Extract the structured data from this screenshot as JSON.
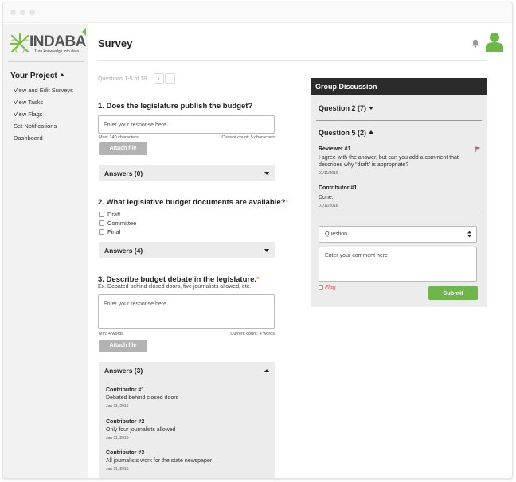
{
  "brand": {
    "name": "INDABA",
    "tagline": "Turn knowledge into data",
    "accent": "#7cbf3f"
  },
  "sidebar": {
    "project": "Your Project",
    "items": [
      {
        "label": "View and Edit Surveys"
      },
      {
        "label": "View Tasks"
      },
      {
        "label": "View Flags"
      },
      {
        "label": "Set Notifications"
      },
      {
        "label": "Dashboard"
      }
    ]
  },
  "header": {
    "title": "Survey",
    "icons": [
      "bell-icon",
      "user-avatar-icon"
    ]
  },
  "pager": {
    "label": "Questions 1-5 of 18",
    "prev": "‹",
    "next": "›"
  },
  "questions": [
    {
      "title": "1. Does the legislature publish the budget?",
      "placeholder": "Enter your response here",
      "limit": "Max: 140 characters",
      "count": "Current count: 5 characters",
      "attach": "Attach file",
      "answers_label": "Answers (0)"
    },
    {
      "title": "2. What legislative budget documents are available?",
      "required": "*",
      "options": [
        "Draft",
        "Committee",
        "Final"
      ],
      "answers_label": "Answers (4)"
    },
    {
      "title": "3. Describe budget debate in the legislature.",
      "required": "*",
      "hint": "Ex. Debated behind closed doors, five journalists allowed, etc.",
      "placeholder": "Enter your response here",
      "limit": "Min: 4 words",
      "count": "Current count: 4 words",
      "attach": "Attach file",
      "answers_label": "Answers (3)",
      "answers": [
        {
          "name": "Contributor #1",
          "text": "Debated behind closed doors",
          "date": "Jan 11, 2016"
        },
        {
          "name": "Contributor #2",
          "text": "Only four journalists allowed",
          "date": "Jan 11, 2016"
        },
        {
          "name": "Contributor #3",
          "text": "All journalists work for the state newspaper",
          "date": "Jan 11, 2016"
        }
      ]
    }
  ],
  "discussion": {
    "title": "Group Discussion",
    "collapsed_section": "Question 2 (7)",
    "open_section": "Question 5 (2)",
    "comments": [
      {
        "name": "Reviewer #1",
        "text": "I agree with the answer, but can you add a comment that describes why “draft” is appropriate?",
        "date": "01/11/2016",
        "flagged": true
      },
      {
        "name": "Contributor #1",
        "text": "Done.",
        "date": "01/11/2016",
        "flagged": false
      }
    ],
    "select_value": "Question",
    "comment_placeholder": "Enter your comment here",
    "flag_label": "Flag",
    "submit_label": "Submit",
    "submit_color": "#6fb64a",
    "flag_color": "#d9534f"
  }
}
